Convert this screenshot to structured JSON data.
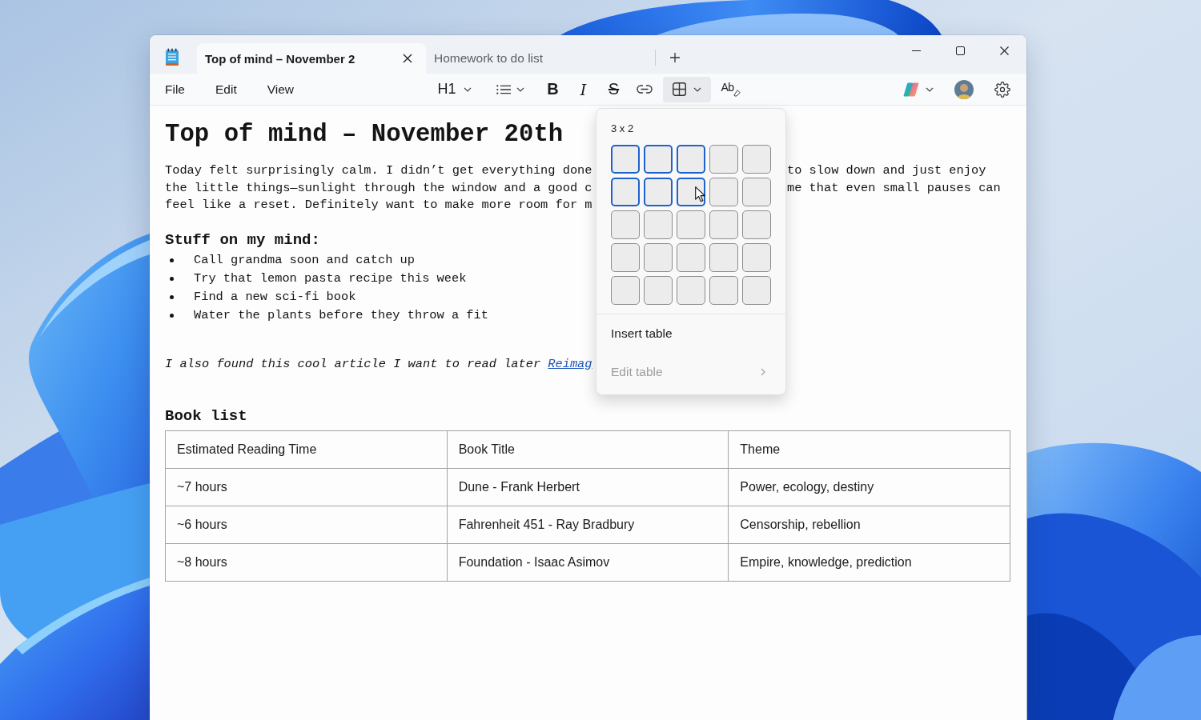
{
  "window": {
    "tabs": [
      {
        "title": "Top of mind – November 2",
        "selected": true
      },
      {
        "title": "Homework to do list",
        "selected": false
      }
    ]
  },
  "menu_bar": [
    "File",
    "Edit",
    "View"
  ],
  "toolbar": {
    "heading_button": {
      "label": "H1"
    },
    "format_buttons": [
      {
        "kind": "bold",
        "label": "B"
      },
      {
        "kind": "italic",
        "label": "I"
      },
      {
        "kind": "strikethrough",
        "label": "S"
      }
    ],
    "table_button": {
      "expanded": true
    },
    "clear_formatting_button": {
      "label": "Ab"
    }
  },
  "document": {
    "title": "Top of mind – November 20th",
    "paragraph_lines": [
      {
        "text_left": "Today felt surprisingly calm. I didn’t get everything done",
        "text_right": "to slow down and just enjoy"
      },
      {
        "text_left": "the little things—sunlight through the window and a good c",
        "text_right": "me that even small pauses can"
      },
      {
        "text_left": "feel like a reset. Definitely want to make more room for m"
      }
    ],
    "list_heading": "Stuff on my mind:",
    "bullets": [
      "Call grandma soon and catch up",
      "Try that lemon pasta recipe this week",
      "Find a new sci-fi book",
      "Water the plants before they throw a fit"
    ],
    "note": {
      "text": "I also found this cool article I want to read later",
      "link": "Reimag"
    },
    "table_heading": "Book list",
    "table": {
      "columns": [
        "Estimated Reading Time",
        "Book Title",
        "Theme"
      ],
      "rows": [
        [
          "~7 hours",
          "Dune - Frank Herbert",
          "Power, ecology, destiny"
        ],
        [
          "~6 hours",
          "Fahrenheit 451 - Ray Bradbury",
          "Censorship, rebellion"
        ],
        [
          "~8 hours",
          "Foundation - Isaac Asimov",
          "Empire, knowledge, prediction"
        ]
      ]
    }
  },
  "table_menu": {
    "size_label": "3 x 2",
    "rows": [
      {
        "cells": [
          {
            "selected": true
          },
          {
            "selected": true
          },
          {
            "selected": true
          },
          {
            "selected": false
          },
          {
            "selected": false
          }
        ]
      },
      {
        "cells": [
          {
            "selected": true
          },
          {
            "selected": true
          },
          {
            "selected": true
          },
          {
            "selected": false
          },
          {
            "selected": false
          }
        ]
      },
      {
        "cells": [
          {
            "selected": false
          },
          {
            "selected": false
          },
          {
            "selected": false
          },
          {
            "selected": false
          },
          {
            "selected": false
          }
        ]
      },
      {
        "cells": [
          {
            "selected": false
          },
          {
            "selected": false
          },
          {
            "selected": false
          },
          {
            "selected": false
          },
          {
            "selected": false
          }
        ]
      },
      {
        "cells": [
          {
            "selected": false
          },
          {
            "selected": false
          },
          {
            "selected": false
          },
          {
            "selected": false
          },
          {
            "selected": false
          }
        ]
      }
    ],
    "items": [
      {
        "label": "Insert table",
        "disabled": false,
        "submenu": false
      },
      {
        "label": "Edit table",
        "disabled": true,
        "submenu": true
      }
    ]
  }
}
